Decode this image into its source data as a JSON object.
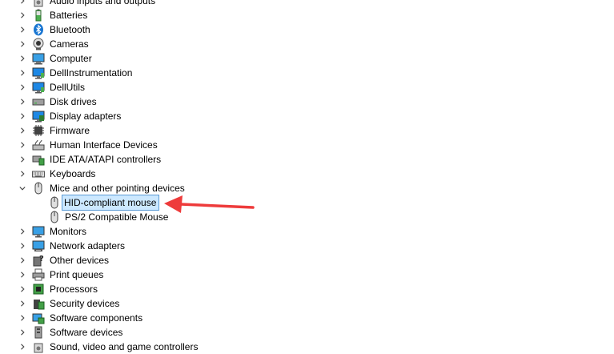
{
  "tree": {
    "items": [
      {
        "label": "Audio inputs and outputs",
        "icon": "speaker-icon"
      },
      {
        "label": "Batteries",
        "icon": "battery-icon"
      },
      {
        "label": "Bluetooth",
        "icon": "bluetooth-icon"
      },
      {
        "label": "Cameras",
        "icon": "camera-icon"
      },
      {
        "label": "Computer",
        "icon": "computer-icon"
      },
      {
        "label": "DellInstrumentation",
        "icon": "monitor-icon"
      },
      {
        "label": "DellUtils",
        "icon": "monitor-icon"
      },
      {
        "label": "Disk drives",
        "icon": "disk-drive-icon"
      },
      {
        "label": "Display adapters",
        "icon": "display-adapter-icon"
      },
      {
        "label": "Firmware",
        "icon": "chip-icon"
      },
      {
        "label": "Human Interface Devices",
        "icon": "hid-icon"
      },
      {
        "label": "IDE ATA/ATAPI controllers",
        "icon": "ide-controller-icon"
      },
      {
        "label": "Keyboards",
        "icon": "keyboard-icon"
      },
      {
        "label": "Mice and other pointing devices",
        "icon": "mouse-icon"
      },
      {
        "label": "HID-compliant mouse",
        "icon": "mouse-icon"
      },
      {
        "label": "PS/2 Compatible Mouse",
        "icon": "mouse-icon"
      },
      {
        "label": "Monitors",
        "icon": "monitor-icon"
      },
      {
        "label": "Network adapters",
        "icon": "network-adapter-icon"
      },
      {
        "label": "Other devices",
        "icon": "unknown-device-icon"
      },
      {
        "label": "Print queues",
        "icon": "printer-icon"
      },
      {
        "label": "Processors",
        "icon": "processor-icon"
      },
      {
        "label": "Security devices",
        "icon": "security-device-icon"
      },
      {
        "label": "Software components",
        "icon": "software-component-icon"
      },
      {
        "label": "Software devices",
        "icon": "software-device-icon"
      },
      {
        "label": "Sound, video and game controllers",
        "icon": "sound-icon"
      }
    ]
  },
  "colors": {
    "selection_fill": "#cce8ff",
    "selection_border": "#5b9bd5",
    "annotation_arrow": "#ee3b3b"
  }
}
